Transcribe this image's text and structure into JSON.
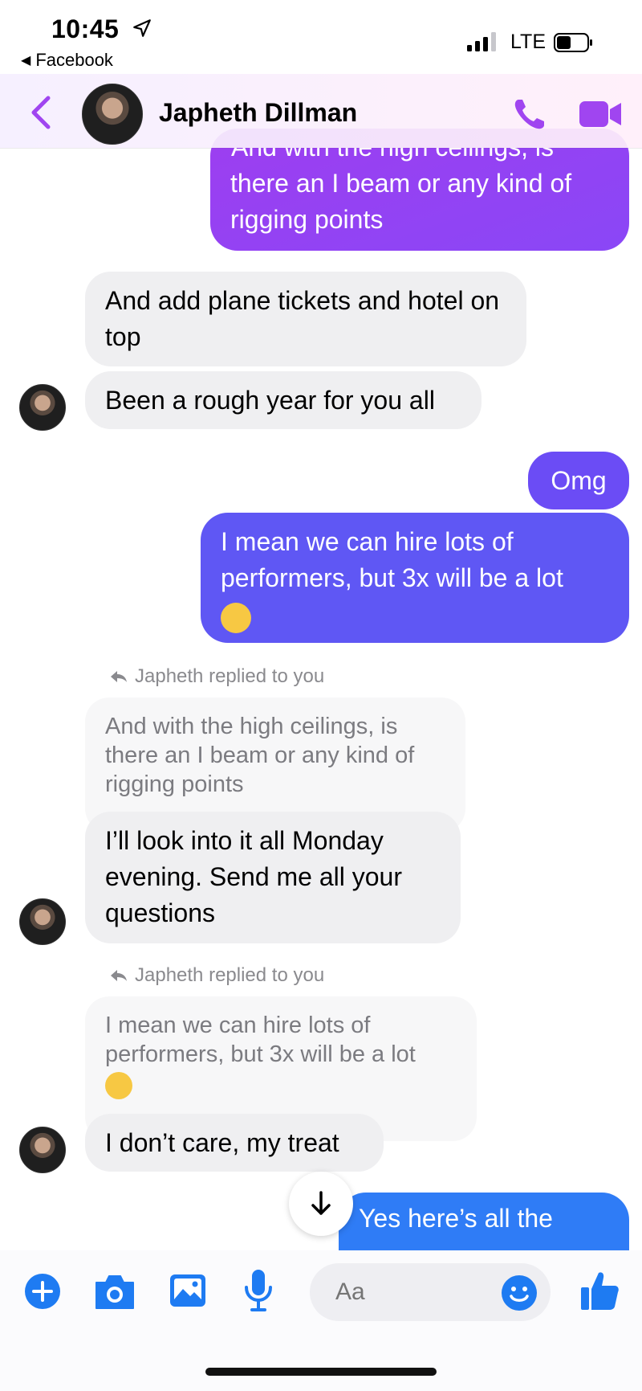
{
  "status_bar": {
    "time": "10:45",
    "back_app": "Facebook",
    "network": "LTE"
  },
  "header": {
    "contact_name": "Japheth Dillman"
  },
  "messages": {
    "m1_partial_top": "And with the high ceilings, is",
    "m1": "there an I beam or any kind of rigging points",
    "m2": "And add plane tickets and hotel on top",
    "m3": "Been a rough year for you all",
    "m4": "Omg",
    "m5": "I mean we can hire lots of performers, but 3x will be a lot",
    "reply1_label": "Japheth replied to you",
    "quote1": "And with the high ceilings, is there an I beam or any kind of rigging points",
    "m6": "I’ll look into it all Monday evening.  Send me all your questions",
    "reply2_label": "Japheth replied to you",
    "quote2": "I mean we can hire lots of performers, but 3x will be a lot",
    "m7": "I don’t care, my treat",
    "m8": "Yes here’s all the"
  },
  "composer": {
    "placeholder": "Aa"
  },
  "colors": {
    "accent_purple": "#9b3ff0",
    "accent_blue": "#2f7cf6",
    "incoming_bubble": "#efeff1"
  },
  "icons": [
    "location-arrow-icon",
    "signal-icon",
    "battery-icon",
    "back-chevron-icon",
    "phone-icon",
    "video-icon",
    "reply-arrow-icon",
    "scroll-down-arrow-icon",
    "plus-icon",
    "camera-icon",
    "photo-icon",
    "microphone-icon",
    "emoji-icon",
    "thumbs-up-icon"
  ]
}
